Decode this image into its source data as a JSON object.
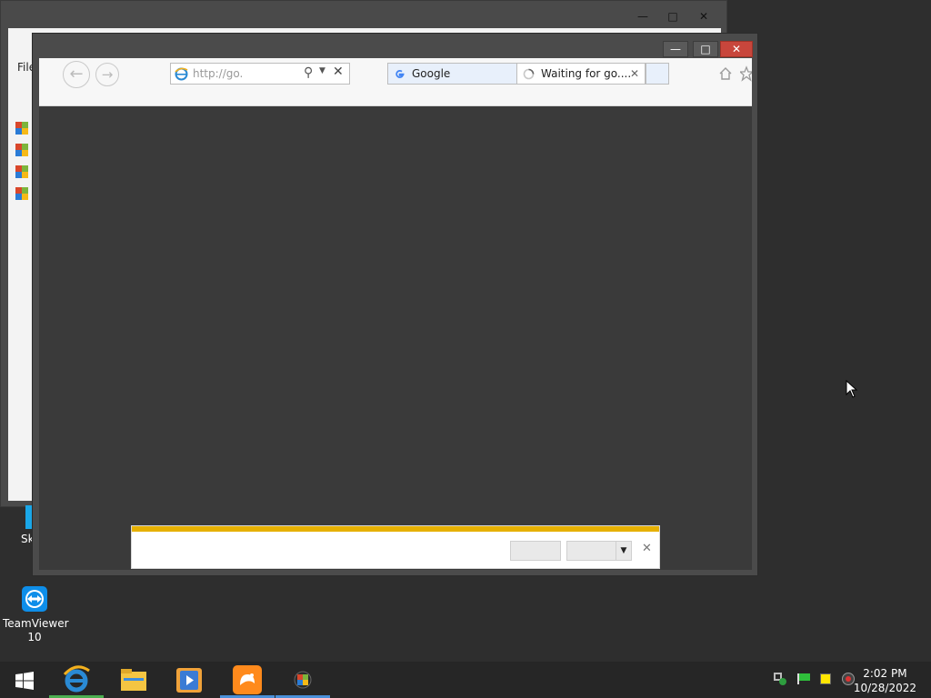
{
  "background_window": {
    "menu_label": "File",
    "icon_names": [
      "app-icon",
      "app-icon",
      "app-icon",
      "app-icon"
    ]
  },
  "desktop": {
    "icons": [
      {
        "label": "Sk",
        "icon": "skype-icon"
      },
      {
        "label": "TeamViewer 10",
        "icon": "teamviewer-icon"
      }
    ]
  },
  "browser": {
    "address": "http://go.",
    "tabs": [
      {
        "label": "Google",
        "icon": "google-icon",
        "state": "inactive"
      },
      {
        "label": "Waiting for go....",
        "icon": "loading-spinner-icon",
        "state": "active"
      }
    ]
  },
  "notification_bar": {
    "accent_color": "#e6b000",
    "button1": "",
    "button2": ""
  },
  "taskbar": {
    "apps": [
      "start-button",
      "internet-explorer-icon",
      "file-explorer-icon",
      "media-player-icon",
      "uc-browser-icon",
      "app-icon"
    ],
    "tray_icons": [
      "network-icon",
      "flag-icon",
      "display-icon",
      "volume-icon"
    ],
    "time": "2:02 PM",
    "date": "10/28/2022"
  }
}
